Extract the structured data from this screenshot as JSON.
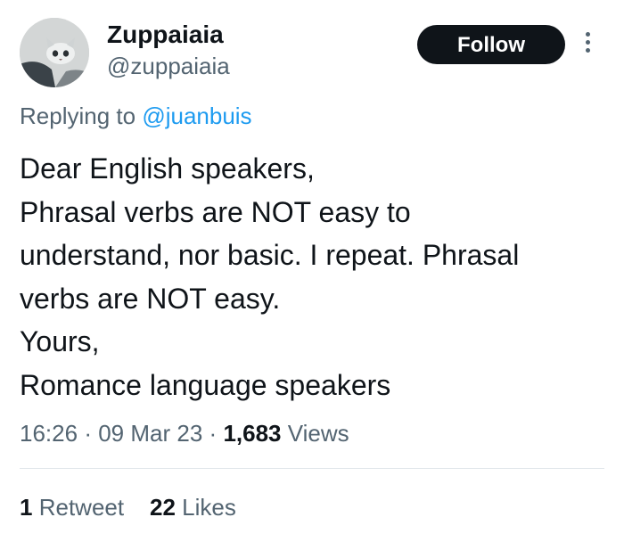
{
  "author": {
    "display_name": "Zuppaiaia",
    "handle": "@zuppaiaia",
    "avatar_icon": "cat-avatar-icon"
  },
  "header": {
    "follow_label": "Follow",
    "more_icon": "more-vertical-icon"
  },
  "reply": {
    "prefix": "Replying to",
    "target": "@juanbuis"
  },
  "tweet": {
    "lines": [
      "Dear English speakers,",
      "Phrasal verbs are NOT easy to",
      "understand, nor basic. I repeat. Phrasal",
      "verbs are NOT easy.",
      "Yours,",
      "Romance language speakers"
    ]
  },
  "meta": {
    "time": "16:26",
    "date": "09 Mar 23",
    "views_count": "1,683",
    "views_label": "Views",
    "separator": "·"
  },
  "stats": {
    "retweets_count": "1",
    "retweets_label": "Retweet",
    "likes_count": "22",
    "likes_label": "Likes"
  },
  "colors": {
    "text_primary": "#0f1419",
    "text_secondary": "#536471",
    "link": "#1d9bf0",
    "button_bg": "#0f1419",
    "divider": "#e1e6ea"
  }
}
